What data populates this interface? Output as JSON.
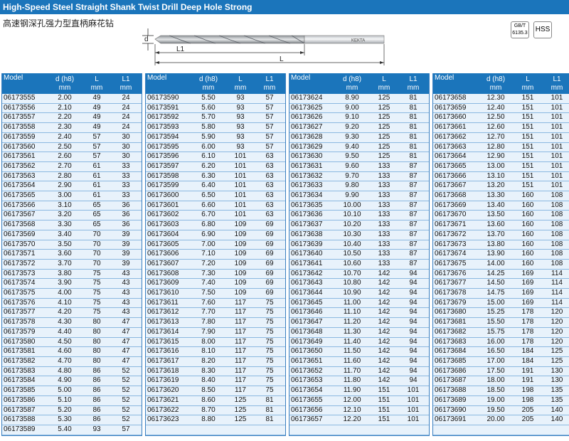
{
  "header": {
    "title": "High-Speed Steel Straight Shank Twist Drill Deep Hole Strong",
    "subtitle": "高速钢深孔强力型直柄麻花钻"
  },
  "drawing": {
    "d": "d",
    "L1": "L1",
    "L": "L",
    "brand": "KEKTA"
  },
  "badges": {
    "standard_line1": "GB/T",
    "standard_line2": "6135.3",
    "material": "HSS"
  },
  "columns": {
    "model": "Model",
    "d": "d (h8)",
    "d_unit": "mm",
    "L": "L",
    "L_unit": "mm",
    "L1": "L1",
    "L1_unit": "mm"
  },
  "tables": [
    [
      [
        "06173555",
        "2.00",
        "49",
        "24"
      ],
      [
        "06173556",
        "2.10",
        "49",
        "24"
      ],
      [
        "06173557",
        "2.20",
        "49",
        "24"
      ],
      [
        "06173558",
        "2.30",
        "49",
        "24"
      ],
      [
        "06173559",
        "2.40",
        "57",
        "30"
      ],
      [
        "06173560",
        "2.50",
        "57",
        "30"
      ],
      [
        "06173561",
        "2.60",
        "57",
        "30"
      ],
      [
        "06173562",
        "2.70",
        "61",
        "33"
      ],
      [
        "06173563",
        "2.80",
        "61",
        "33"
      ],
      [
        "06173564",
        "2.90",
        "61",
        "33"
      ],
      [
        "06173565",
        "3.00",
        "61",
        "33"
      ],
      [
        "06173566",
        "3.10",
        "65",
        "36"
      ],
      [
        "06173567",
        "3.20",
        "65",
        "36"
      ],
      [
        "06173568",
        "3.30",
        "65",
        "36"
      ],
      [
        "06173569",
        "3.40",
        "70",
        "39"
      ],
      [
        "06173570",
        "3.50",
        "70",
        "39"
      ],
      [
        "06173571",
        "3.60",
        "70",
        "39"
      ],
      [
        "06173572",
        "3.70",
        "70",
        "39"
      ],
      [
        "06173573",
        "3.80",
        "75",
        "43"
      ],
      [
        "06173574",
        "3.90",
        "75",
        "43"
      ],
      [
        "06173575",
        "4.00",
        "75",
        "43"
      ],
      [
        "06173576",
        "4.10",
        "75",
        "43"
      ],
      [
        "06173577",
        "4.20",
        "75",
        "43"
      ],
      [
        "06173578",
        "4.30",
        "80",
        "47"
      ],
      [
        "06173579",
        "4.40",
        "80",
        "47"
      ],
      [
        "06173580",
        "4.50",
        "80",
        "47"
      ],
      [
        "06173581",
        "4.60",
        "80",
        "47"
      ],
      [
        "06173582",
        "4.70",
        "80",
        "47"
      ],
      [
        "06173583",
        "4.80",
        "86",
        "52"
      ],
      [
        "06173584",
        "4.90",
        "86",
        "52"
      ],
      [
        "06173585",
        "5.00",
        "86",
        "52"
      ],
      [
        "06173586",
        "5.10",
        "86",
        "52"
      ],
      [
        "06173587",
        "5.20",
        "86",
        "52"
      ],
      [
        "06173588",
        "5.30",
        "86",
        "52"
      ],
      [
        "06173589",
        "5.40",
        "93",
        "57"
      ]
    ],
    [
      [
        "06173590",
        "5.50",
        "93",
        "57"
      ],
      [
        "06173591",
        "5.60",
        "93",
        "57"
      ],
      [
        "06173592",
        "5.70",
        "93",
        "57"
      ],
      [
        "06173593",
        "5.80",
        "93",
        "57"
      ],
      [
        "06173594",
        "5.90",
        "93",
        "57"
      ],
      [
        "06173595",
        "6.00",
        "93",
        "57"
      ],
      [
        "06173596",
        "6.10",
        "101",
        "63"
      ],
      [
        "06173597",
        "6.20",
        "101",
        "63"
      ],
      [
        "06173598",
        "6.30",
        "101",
        "63"
      ],
      [
        "06173599",
        "6.40",
        "101",
        "63"
      ],
      [
        "06173600",
        "6.50",
        "101",
        "63"
      ],
      [
        "06173601",
        "6.60",
        "101",
        "63"
      ],
      [
        "06173602",
        "6.70",
        "101",
        "63"
      ],
      [
        "06173603",
        "6.80",
        "109",
        "69"
      ],
      [
        "06173604",
        "6.90",
        "109",
        "69"
      ],
      [
        "06173605",
        "7.00",
        "109",
        "69"
      ],
      [
        "06173606",
        "7.10",
        "109",
        "69"
      ],
      [
        "06173607",
        "7.20",
        "109",
        "69"
      ],
      [
        "06173608",
        "7.30",
        "109",
        "69"
      ],
      [
        "06173609",
        "7.40",
        "109",
        "69"
      ],
      [
        "06173610",
        "7.50",
        "109",
        "69"
      ],
      [
        "06173611",
        "7.60",
        "117",
        "75"
      ],
      [
        "06173612",
        "7.70",
        "117",
        "75"
      ],
      [
        "06173613",
        "7.80",
        "117",
        "75"
      ],
      [
        "06173614",
        "7.90",
        "117",
        "75"
      ],
      [
        "06173615",
        "8.00",
        "117",
        "75"
      ],
      [
        "06173616",
        "8.10",
        "117",
        "75"
      ],
      [
        "06173617",
        "8.20",
        "117",
        "75"
      ],
      [
        "06173618",
        "8.30",
        "117",
        "75"
      ],
      [
        "06173619",
        "8.40",
        "117",
        "75"
      ],
      [
        "06173620",
        "8.50",
        "117",
        "75"
      ],
      [
        "06173621",
        "8.60",
        "125",
        "81"
      ],
      [
        "06173622",
        "8.70",
        "125",
        "81"
      ],
      [
        "06173623",
        "8.80",
        "125",
        "81"
      ],
      [
        "",
        "",
        "",
        ""
      ]
    ],
    [
      [
        "06173624",
        "8.90",
        "125",
        "81"
      ],
      [
        "06173625",
        "9.00",
        "125",
        "81"
      ],
      [
        "06173626",
        "9.10",
        "125",
        "81"
      ],
      [
        "06173627",
        "9.20",
        "125",
        "81"
      ],
      [
        "06173628",
        "9.30",
        "125",
        "81"
      ],
      [
        "06173629",
        "9.40",
        "125",
        "81"
      ],
      [
        "06173630",
        "9.50",
        "125",
        "81"
      ],
      [
        "06173631",
        "9.60",
        "133",
        "87"
      ],
      [
        "06173632",
        "9.70",
        "133",
        "87"
      ],
      [
        "06173633",
        "9.80",
        "133",
        "87"
      ],
      [
        "06173634",
        "9.90",
        "133",
        "87"
      ],
      [
        "06173635",
        "10.00",
        "133",
        "87"
      ],
      [
        "06173636",
        "10.10",
        "133",
        "87"
      ],
      [
        "06173637",
        "10.20",
        "133",
        "87"
      ],
      [
        "06173638",
        "10.30",
        "133",
        "87"
      ],
      [
        "06173639",
        "10.40",
        "133",
        "87"
      ],
      [
        "06173640",
        "10.50",
        "133",
        "87"
      ],
      [
        "06173641",
        "10.60",
        "133",
        "87"
      ],
      [
        "06173642",
        "10.70",
        "142",
        "94"
      ],
      [
        "06173643",
        "10.80",
        "142",
        "94"
      ],
      [
        "06173644",
        "10.90",
        "142",
        "94"
      ],
      [
        "06173645",
        "11.00",
        "142",
        "94"
      ],
      [
        "06173646",
        "11.10",
        "142",
        "94"
      ],
      [
        "06173647",
        "11.20",
        "142",
        "94"
      ],
      [
        "06173648",
        "11.30",
        "142",
        "94"
      ],
      [
        "06173649",
        "11.40",
        "142",
        "94"
      ],
      [
        "06173650",
        "11.50",
        "142",
        "94"
      ],
      [
        "06173651",
        "11.60",
        "142",
        "94"
      ],
      [
        "06173652",
        "11.70",
        "142",
        "94"
      ],
      [
        "06173653",
        "11.80",
        "142",
        "94"
      ],
      [
        "06173654",
        "11.90",
        "151",
        "101"
      ],
      [
        "06173655",
        "12.00",
        "151",
        "101"
      ],
      [
        "06173656",
        "12.10",
        "151",
        "101"
      ],
      [
        "06173657",
        "12.20",
        "151",
        "101"
      ],
      [
        "",
        "",
        "",
        ""
      ]
    ],
    [
      [
        "06173658",
        "12.30",
        "151",
        "101"
      ],
      [
        "06173659",
        "12.40",
        "151",
        "101"
      ],
      [
        "06173660",
        "12.50",
        "151",
        "101"
      ],
      [
        "06173661",
        "12.60",
        "151",
        "101"
      ],
      [
        "06173662",
        "12.70",
        "151",
        "101"
      ],
      [
        "06173663",
        "12.80",
        "151",
        "101"
      ],
      [
        "06173664",
        "12.90",
        "151",
        "101"
      ],
      [
        "06173665",
        "13.00",
        "151",
        "101"
      ],
      [
        "06173666",
        "13.10",
        "151",
        "101"
      ],
      [
        "06173667",
        "13.20",
        "151",
        "101"
      ],
      [
        "06173668",
        "13.30",
        "160",
        "108"
      ],
      [
        "06173669",
        "13.40",
        "160",
        "108"
      ],
      [
        "06173670",
        "13.50",
        "160",
        "108"
      ],
      [
        "06173671",
        "13.60",
        "160",
        "108"
      ],
      [
        "06173672",
        "13.70",
        "160",
        "108"
      ],
      [
        "06173673",
        "13.80",
        "160",
        "108"
      ],
      [
        "06173674",
        "13.90",
        "160",
        "108"
      ],
      [
        "06173675",
        "14.00",
        "160",
        "108"
      ],
      [
        "06173676",
        "14.25",
        "169",
        "114"
      ],
      [
        "06173677",
        "14.50",
        "169",
        "114"
      ],
      [
        "06173678",
        "14.75",
        "169",
        "114"
      ],
      [
        "06173679",
        "15.00",
        "169",
        "114"
      ],
      [
        "06173680",
        "15.25",
        "178",
        "120"
      ],
      [
        "06173681",
        "15.50",
        "178",
        "120"
      ],
      [
        "06173682",
        "15.75",
        "178",
        "120"
      ],
      [
        "06173683",
        "16.00",
        "178",
        "120"
      ],
      [
        "06173684",
        "16.50",
        "184",
        "125"
      ],
      [
        "06173685",
        "17.00",
        "184",
        "125"
      ],
      [
        "06173686",
        "17.50",
        "191",
        "130"
      ],
      [
        "06173687",
        "18.00",
        "191",
        "130"
      ],
      [
        "06173688",
        "18.50",
        "198",
        "135"
      ],
      [
        "06173689",
        "19.00",
        "198",
        "135"
      ],
      [
        "06173690",
        "19.50",
        "205",
        "140"
      ],
      [
        "06173691",
        "20.00",
        "205",
        "140"
      ],
      [
        "",
        "",
        "",
        ""
      ]
    ]
  ]
}
